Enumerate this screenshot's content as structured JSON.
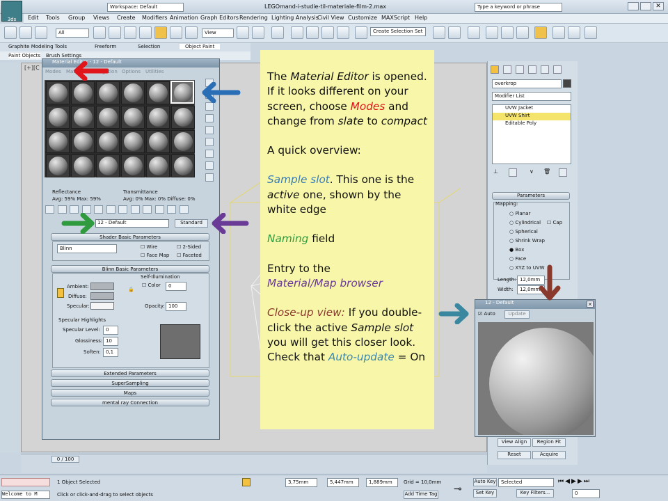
{
  "titlebar": {
    "app_title": "LEGOmand-i-studie-til-materiale-film-2.max",
    "workspace": "Workspace: Default",
    "search_placeholder": "Type a keyword or phrase"
  },
  "menu": [
    "Edit",
    "Tools",
    "Group",
    "Views",
    "Create",
    "Modifiers",
    "Animation",
    "Graph Editors",
    "Rendering",
    "Lighting Analysis",
    "Civil View",
    "Customize",
    "MAXScript",
    "Help"
  ],
  "toolbar": {
    "filter": "All",
    "view": "View",
    "selection_set": "Create Selection Set"
  },
  "ribbon": {
    "tabs": [
      "Graphite Modeling Tools",
      "Freeform",
      "Selection",
      "Object Paint"
    ],
    "subtabs": [
      "Paint Objects",
      "Brush Settings"
    ]
  },
  "viewport_label": "[+][C",
  "material_editor": {
    "title": "Material Editor - 12 - Default",
    "menu": [
      "Modes",
      "Material",
      "Navigation",
      "Options",
      "Utilities"
    ],
    "reflectance_label": "Reflectance",
    "reflectance_vals": "Avg: 59% Max: 59%",
    "transmittance_label": "Transmittance",
    "transmittance_vals": "Avg:   0% Max:  0%   Diffuse:   0%",
    "name": "12 - Default",
    "type_button": "Standard",
    "shader_rollout": "Shader Basic Parameters",
    "shader": "Blinn",
    "wire": "Wire",
    "two_sided": "2-Sided",
    "face_map": "Face Map",
    "faceted": "Faceted",
    "blinn_rollout": "Blinn Basic Parameters",
    "self_illum": "Self-Illumination",
    "color": "Color",
    "color_val": "0",
    "ambient": "Ambient:",
    "diffuse": "Diffuse:",
    "specular": "Specular:",
    "opacity": "Opacity:",
    "opacity_val": "100",
    "spec_highlights": "Specular Highlights",
    "spec_level": "Specular Level:",
    "spec_level_val": "0",
    "glossiness": "Glossiness:",
    "glossiness_val": "10",
    "soften": "Soften:",
    "soften_val": "0,1",
    "rollouts": [
      "Extended Parameters",
      "SuperSampling",
      "Maps",
      "mental ray Connection"
    ]
  },
  "modifier_panel": {
    "object_name": "overkrop",
    "modifier_list": "Modifier List",
    "stack": [
      "UVW Jacket",
      "UVW Shirt",
      "Editable Poly"
    ],
    "parameters": "Parameters",
    "mapping": "Mapping:",
    "options": [
      "Planar",
      "Cylindrical",
      "Spherical",
      "Shrink Wrap",
      "Box",
      "Face",
      "XYZ to UVW"
    ],
    "cap": "Cap",
    "length_label": "Length:",
    "length_val": "12,0mm",
    "width_label": "Width:",
    "width_val": "12,0mm",
    "view_align": "View Align",
    "region_fit": "Region Fit",
    "reset": "Reset",
    "acquire": "Acquire"
  },
  "closeup": {
    "title": "12 - Default",
    "auto": "Auto",
    "update": "Update"
  },
  "instructions": {
    "p1_a": "The ",
    "p1_b": "Material Editor",
    "p1_c": " is opened. If it looks different  on your screen, choose ",
    "p1_d": "Modes",
    "p1_e": " and change from ",
    "p1_f": "slate",
    "p1_g": " to ",
    "p1_h": "compact",
    "p2": "A quick overview:",
    "p3_a": "Sample slot",
    "p3_b": ". This one is the ",
    "p3_c": "active",
    "p3_d": " one, shown by the white edge",
    "p4_a": "Naming",
    "p4_b": " field",
    "p5_a": "Entry to the",
    "p5_b": "Material/Map browser",
    "p6_a": "Close-up view:",
    "p6_b": " If you double-click the active ",
    "p6_c": "Sample slot",
    "p6_d": " you will get this closer look. Check that ",
    "p6_e": "Auto-update",
    "p6_f": " = On"
  },
  "status": {
    "timeline": "0 / 100",
    "selected": "1 Object Selected",
    "prompt": "Click or click-and-drag to select objects",
    "x_val": "3,75mm",
    "y_val": "5,447mm",
    "z_val": "1,889mm",
    "grid": "Grid = 10,0mm",
    "auto_key": "Auto Key",
    "set_key": "Set Key",
    "selected_dd": "Selected",
    "key_filters": "Key Filters...",
    "add_time_tag": "Add Time Tag",
    "welcome": "Welcome to M",
    "frame": "0"
  },
  "colors": {
    "instructions_bg": "#f8f7a9",
    "arrow_red": "#e0161b",
    "arrow_blue": "#2a6fb5",
    "arrow_green": "#2f9a3e",
    "arrow_purple": "#6a3a97",
    "arrow_teal": "#3a88a0",
    "arrow_brown": "#8a3a2c"
  }
}
